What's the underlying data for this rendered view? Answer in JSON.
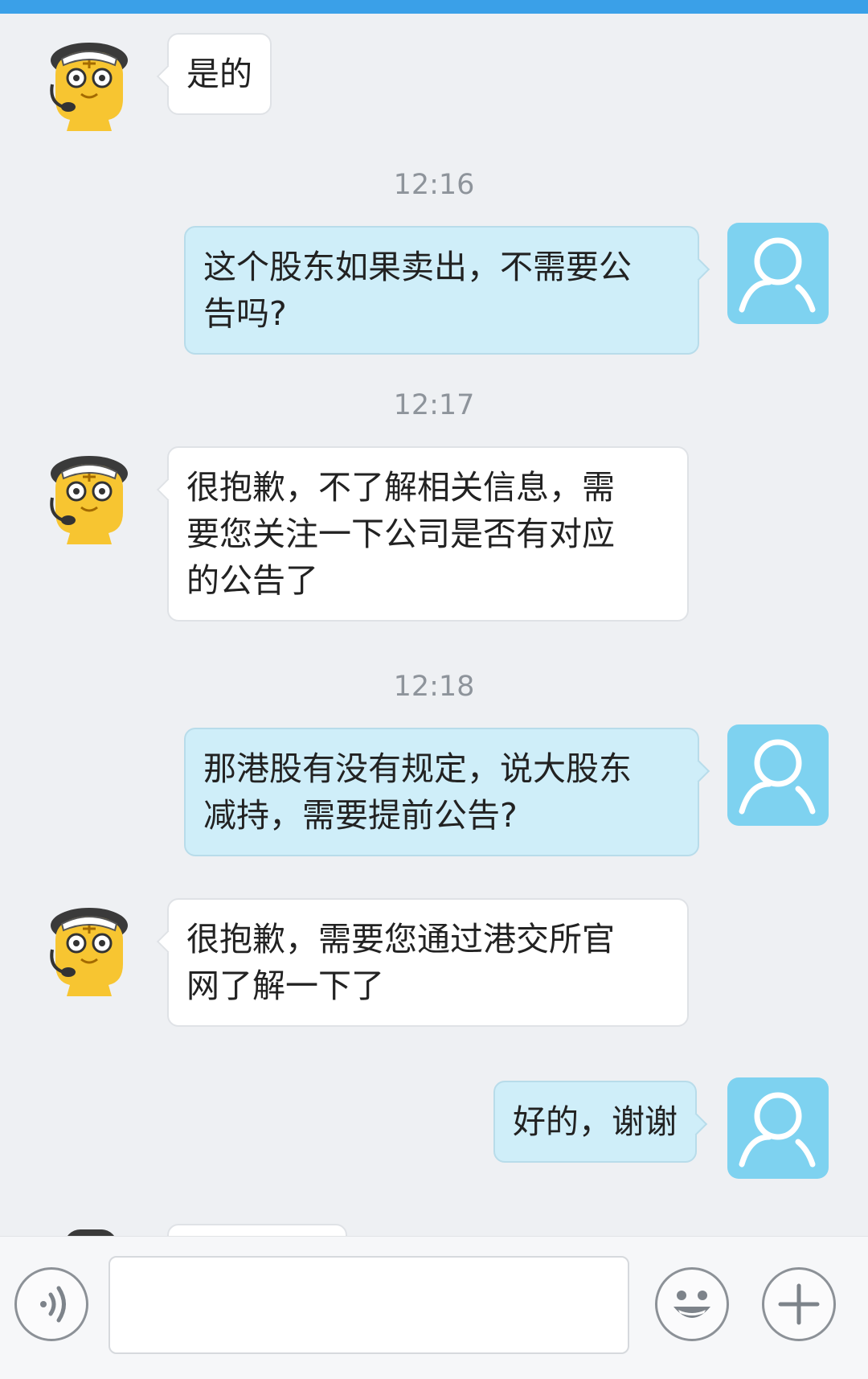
{
  "window": {
    "accent_color": "#3aa0e8"
  },
  "messages": [
    {
      "sender": "bot",
      "lines": [
        "是的"
      ]
    },
    {
      "timestamp": "12:16"
    },
    {
      "sender": "user",
      "lines": [
        "这个股东如果卖出，不需要公",
        "告吗?"
      ]
    },
    {
      "timestamp": "12:17"
    },
    {
      "sender": "bot",
      "lines": [
        "很抱歉，不了解相关信息，需",
        "要您关注一下公司是否有对应",
        "的公告了"
      ]
    },
    {
      "timestamp": "12:18"
    },
    {
      "sender": "user",
      "lines": [
        "那港股有没有规定，说大股东",
        "减持，需要提前公告?"
      ]
    },
    {
      "sender": "bot",
      "lines": [
        "很抱歉，需要您通过港交所官",
        "网了解一下了"
      ]
    },
    {
      "sender": "user",
      "lines": [
        "好的，谢谢"
      ]
    }
  ],
  "input_bar": {
    "voice_icon": "voice-icon",
    "emoji_icon": "emoji-icon",
    "plus_icon": "plus-icon",
    "message_value": ""
  },
  "colors": {
    "user_bubble": "#cfeef9",
    "bot_bubble": "#ffffff",
    "user_avatar": "#7ed2f0"
  }
}
